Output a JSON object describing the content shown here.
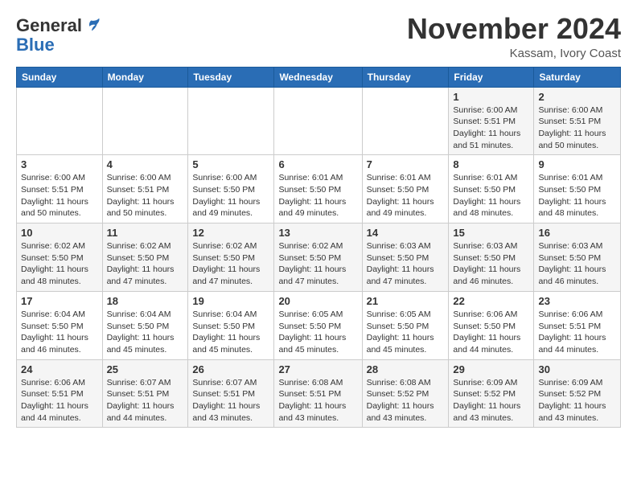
{
  "header": {
    "logo_general": "General",
    "logo_blue": "Blue",
    "month_title": "November 2024",
    "location": "Kassam, Ivory Coast"
  },
  "days_of_week": [
    "Sunday",
    "Monday",
    "Tuesday",
    "Wednesday",
    "Thursday",
    "Friday",
    "Saturday"
  ],
  "weeks": [
    [
      {
        "day": "",
        "info": ""
      },
      {
        "day": "",
        "info": ""
      },
      {
        "day": "",
        "info": ""
      },
      {
        "day": "",
        "info": ""
      },
      {
        "day": "",
        "info": ""
      },
      {
        "day": "1",
        "info": "Sunrise: 6:00 AM\nSunset: 5:51 PM\nDaylight: 11 hours\nand 51 minutes."
      },
      {
        "day": "2",
        "info": "Sunrise: 6:00 AM\nSunset: 5:51 PM\nDaylight: 11 hours\nand 50 minutes."
      }
    ],
    [
      {
        "day": "3",
        "info": "Sunrise: 6:00 AM\nSunset: 5:51 PM\nDaylight: 11 hours\nand 50 minutes."
      },
      {
        "day": "4",
        "info": "Sunrise: 6:00 AM\nSunset: 5:51 PM\nDaylight: 11 hours\nand 50 minutes."
      },
      {
        "day": "5",
        "info": "Sunrise: 6:00 AM\nSunset: 5:50 PM\nDaylight: 11 hours\nand 49 minutes."
      },
      {
        "day": "6",
        "info": "Sunrise: 6:01 AM\nSunset: 5:50 PM\nDaylight: 11 hours\nand 49 minutes."
      },
      {
        "day": "7",
        "info": "Sunrise: 6:01 AM\nSunset: 5:50 PM\nDaylight: 11 hours\nand 49 minutes."
      },
      {
        "day": "8",
        "info": "Sunrise: 6:01 AM\nSunset: 5:50 PM\nDaylight: 11 hours\nand 48 minutes."
      },
      {
        "day": "9",
        "info": "Sunrise: 6:01 AM\nSunset: 5:50 PM\nDaylight: 11 hours\nand 48 minutes."
      }
    ],
    [
      {
        "day": "10",
        "info": "Sunrise: 6:02 AM\nSunset: 5:50 PM\nDaylight: 11 hours\nand 48 minutes."
      },
      {
        "day": "11",
        "info": "Sunrise: 6:02 AM\nSunset: 5:50 PM\nDaylight: 11 hours\nand 47 minutes."
      },
      {
        "day": "12",
        "info": "Sunrise: 6:02 AM\nSunset: 5:50 PM\nDaylight: 11 hours\nand 47 minutes."
      },
      {
        "day": "13",
        "info": "Sunrise: 6:02 AM\nSunset: 5:50 PM\nDaylight: 11 hours\nand 47 minutes."
      },
      {
        "day": "14",
        "info": "Sunrise: 6:03 AM\nSunset: 5:50 PM\nDaylight: 11 hours\nand 47 minutes."
      },
      {
        "day": "15",
        "info": "Sunrise: 6:03 AM\nSunset: 5:50 PM\nDaylight: 11 hours\nand 46 minutes."
      },
      {
        "day": "16",
        "info": "Sunrise: 6:03 AM\nSunset: 5:50 PM\nDaylight: 11 hours\nand 46 minutes."
      }
    ],
    [
      {
        "day": "17",
        "info": "Sunrise: 6:04 AM\nSunset: 5:50 PM\nDaylight: 11 hours\nand 46 minutes."
      },
      {
        "day": "18",
        "info": "Sunrise: 6:04 AM\nSunset: 5:50 PM\nDaylight: 11 hours\nand 45 minutes."
      },
      {
        "day": "19",
        "info": "Sunrise: 6:04 AM\nSunset: 5:50 PM\nDaylight: 11 hours\nand 45 minutes."
      },
      {
        "day": "20",
        "info": "Sunrise: 6:05 AM\nSunset: 5:50 PM\nDaylight: 11 hours\nand 45 minutes."
      },
      {
        "day": "21",
        "info": "Sunrise: 6:05 AM\nSunset: 5:50 PM\nDaylight: 11 hours\nand 45 minutes."
      },
      {
        "day": "22",
        "info": "Sunrise: 6:06 AM\nSunset: 5:50 PM\nDaylight: 11 hours\nand 44 minutes."
      },
      {
        "day": "23",
        "info": "Sunrise: 6:06 AM\nSunset: 5:51 PM\nDaylight: 11 hours\nand 44 minutes."
      }
    ],
    [
      {
        "day": "24",
        "info": "Sunrise: 6:06 AM\nSunset: 5:51 PM\nDaylight: 11 hours\nand 44 minutes."
      },
      {
        "day": "25",
        "info": "Sunrise: 6:07 AM\nSunset: 5:51 PM\nDaylight: 11 hours\nand 44 minutes."
      },
      {
        "day": "26",
        "info": "Sunrise: 6:07 AM\nSunset: 5:51 PM\nDaylight: 11 hours\nand 43 minutes."
      },
      {
        "day": "27",
        "info": "Sunrise: 6:08 AM\nSunset: 5:51 PM\nDaylight: 11 hours\nand 43 minutes."
      },
      {
        "day": "28",
        "info": "Sunrise: 6:08 AM\nSunset: 5:52 PM\nDaylight: 11 hours\nand 43 minutes."
      },
      {
        "day": "29",
        "info": "Sunrise: 6:09 AM\nSunset: 5:52 PM\nDaylight: 11 hours\nand 43 minutes."
      },
      {
        "day": "30",
        "info": "Sunrise: 6:09 AM\nSunset: 5:52 PM\nDaylight: 11 hours\nand 43 minutes."
      }
    ]
  ]
}
